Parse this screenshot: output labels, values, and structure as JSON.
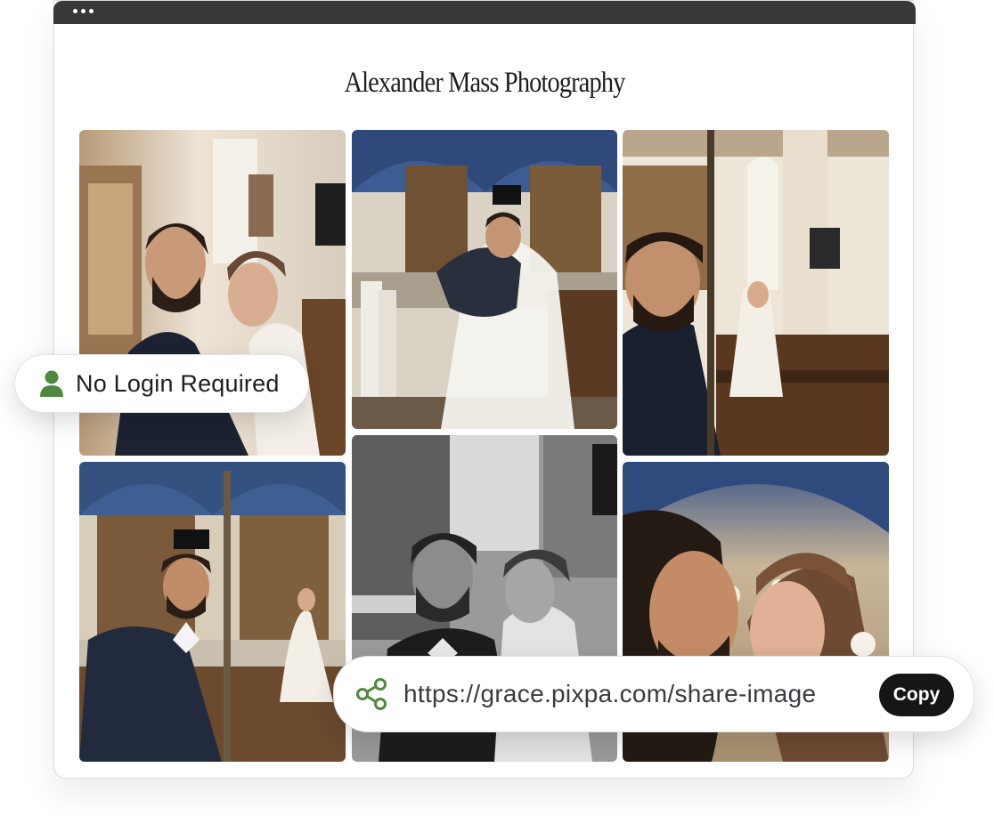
{
  "site": {
    "title": "Alexander Mass Photography"
  },
  "badges": {
    "login": {
      "label": "No Login Required",
      "icon": "user-icon"
    }
  },
  "share": {
    "url": "https://grace.pixpa.com/share-image",
    "copy_label": "Copy",
    "icon": "share-icon"
  },
  "colors": {
    "accent": "#4f8a3c",
    "titlebar": "#383838",
    "copy_button": "#161616"
  }
}
